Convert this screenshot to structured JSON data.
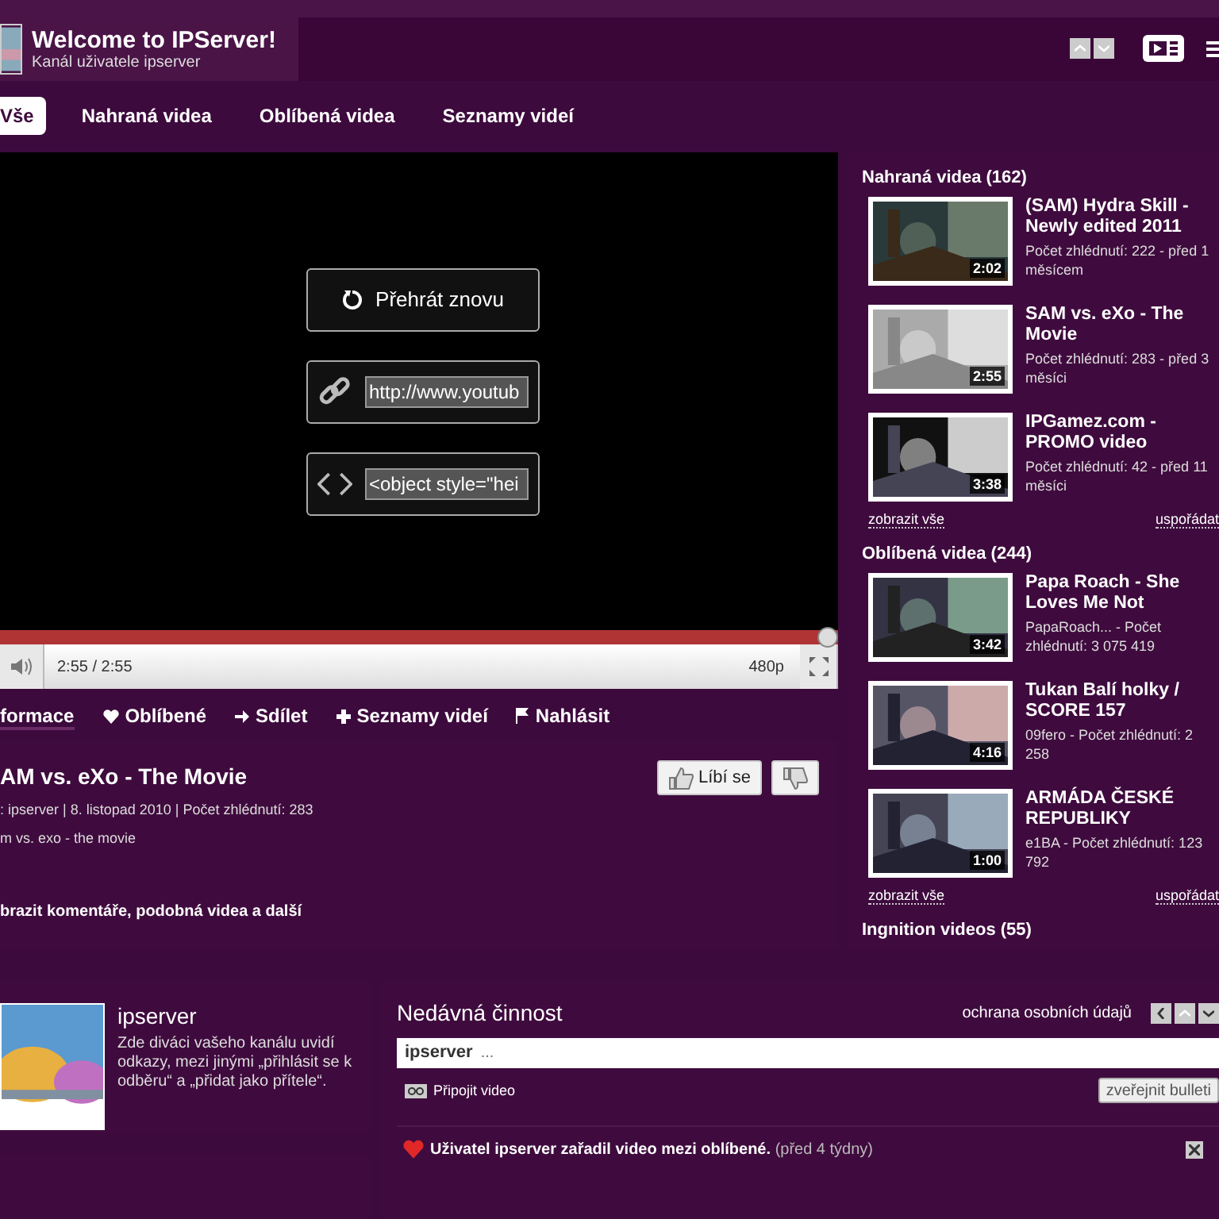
{
  "header": {
    "title": "Welcome to IPServer!",
    "subtitle": "Kanál uživatele ipserver"
  },
  "tabs": [
    {
      "label": "Vše",
      "selected": true
    },
    {
      "label": "Nahraná videa",
      "selected": false
    },
    {
      "label": "Oblíbená videa",
      "selected": false
    },
    {
      "label": "Seznamy videí",
      "selected": false
    }
  ],
  "player": {
    "replay": "Přehrát znovu",
    "url": "http://www.youtub",
    "embed": "<object style=\"hei",
    "progress": {
      "level": 1
    },
    "time": "2:55 / 2:55",
    "quality": "480p"
  },
  "actions": [
    {
      "kind": "info",
      "label": "formace",
      "selected": true
    },
    {
      "kind": "favorite",
      "label": "Oblíbené",
      "selected": false
    },
    {
      "kind": "share",
      "label": "Sdílet",
      "selected": false
    },
    {
      "kind": "playlist",
      "label": "Seznamy videí",
      "selected": false
    },
    {
      "kind": "report",
      "label": "Nahlásit",
      "selected": false
    }
  ],
  "video_info": {
    "title": "AM vs. eXo - The Movie",
    "meta": ": ipserver | 8. listopad 2010  | Počet zhlédnutí: 283",
    "description": "m vs. exo - the movie",
    "like": "Líbí se",
    "more": "brazit komentáře, podobná videa a další"
  },
  "sidebar": [
    {
      "heading": "Nahraná videa (162)",
      "videos": [
        {
          "title": "(SAM) Hydra Skill - Newly edited 2011",
          "meta": "Počet zhlédnutí: 222 - před 1 měsícem",
          "duration": "2:02"
        },
        {
          "title": "SAM vs. eXo - The Movie",
          "meta": "Počet zhlédnutí: 283 - před 3 měsíci",
          "duration": "2:55"
        },
        {
          "title": "IPGamez.com - PROMO video",
          "meta": "Počet zhlédnutí: 42 - před 11 měsíci",
          "duration": "3:38"
        }
      ],
      "show_all": "zobrazit vše",
      "arrange": "uspořádat"
    },
    {
      "heading": "Oblíbená videa (244)",
      "videos": [
        {
          "title": "Papa Roach - She Loves Me Not",
          "meta": "PapaRoach... - Počet zhlédnutí: 3 075 419",
          "duration": "3:42"
        },
        {
          "title": "Tukan Balí holky / SCORE 157",
          "meta": "09fero - Počet zhlédnutí: 2 258",
          "duration": "4:16"
        },
        {
          "title": "ARMÁDA ČESKÉ REPUBLIKY",
          "meta": "e1BA - Počet zhlédnutí: 123 792",
          "duration": "1:00"
        }
      ],
      "show_all": "zobrazit vše",
      "arrange": "uspořádat"
    },
    {
      "heading": "Ingnition videos (55)"
    }
  ],
  "profile": {
    "name": "ipserver",
    "description": "Zde diváci vašeho kanálu uvidí odkazy, mezi jinými „přihlásit se k odběru“ a „přidat jako přítele“."
  },
  "activity": {
    "title": "Nedávná činnost",
    "privacy": "ochrana osobních údajů",
    "composer": {
      "value": "ipserver",
      "placeholder": "..."
    },
    "attach": "Připojit video",
    "publish": "zveřejnit bulleti",
    "item": {
      "text": "Uživatel ipserver zařadil video mezi oblíbené.",
      "time": "(před 4 týdny)"
    }
  }
}
